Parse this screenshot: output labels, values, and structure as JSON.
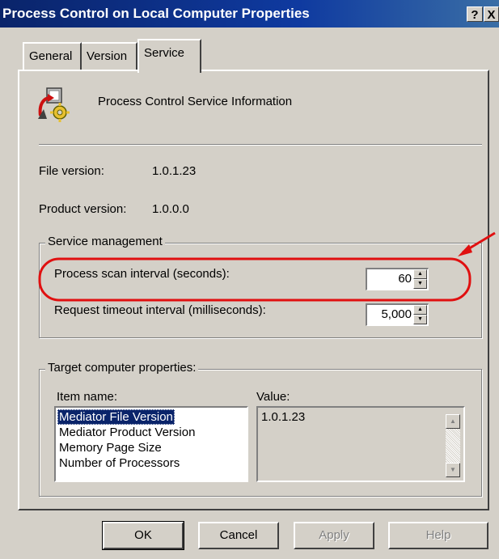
{
  "window": {
    "title": "Process Control on Local Computer Properties",
    "help_button": "?",
    "close_button": "X"
  },
  "tabs": [
    {
      "label": "General",
      "active": false
    },
    {
      "label": "Version",
      "active": false
    },
    {
      "label": "Service",
      "active": true
    }
  ],
  "service_info": {
    "heading": "Process Control Service Information",
    "icon": "service-gear-icon"
  },
  "versions": {
    "file_label": "File version:",
    "file_value": "1.0.1.23",
    "product_label": "Product version:",
    "product_value": "1.0.0.0"
  },
  "service_management": {
    "legend": "Service management",
    "scan_label": "Process scan interval (seconds):",
    "scan_value": "60",
    "timeout_label": "Request timeout interval (milliseconds):",
    "timeout_value": "5,000"
  },
  "target_properties": {
    "legend": "Target computer properties:",
    "item_header": "Item name:",
    "value_header": "Value:",
    "items": [
      "Mediator File Version",
      "Mediator Product Version",
      "Memory Page Size",
      "Number of Processors"
    ],
    "selected_index": 0,
    "value": "1.0.1.23"
  },
  "buttons": {
    "ok": "OK",
    "cancel": "Cancel",
    "apply": "Apply",
    "help": "Help"
  },
  "annotation": {
    "color": "#e01010"
  }
}
